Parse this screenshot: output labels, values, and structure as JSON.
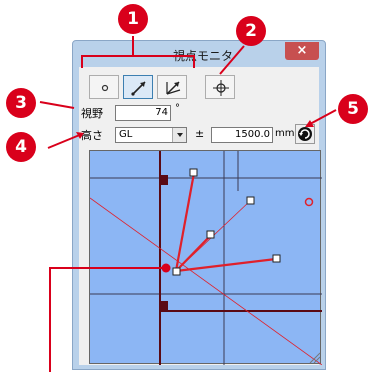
{
  "window": {
    "title": "視点モニタ",
    "close_label": "×"
  },
  "toolbar": {
    "buttons": [
      {
        "icon": "dot-icon",
        "active": false
      },
      {
        "icon": "pen-arrow-icon",
        "active": true
      },
      {
        "icon": "pen-multi-arrow-icon",
        "active": false
      },
      {
        "icon": "crosshair-icon",
        "active": false
      }
    ]
  },
  "view_field": {
    "label": "視野",
    "value": "74",
    "unit": "°"
  },
  "height_field": {
    "label": "高さ",
    "level_value": "GL",
    "plus_minus": "±",
    "offset_value": "1500.0",
    "unit": "mm"
  },
  "callouts": [
    "1",
    "2",
    "3",
    "4",
    "5"
  ],
  "colors": {
    "accent": "#d9001b",
    "viewport_bg": "#8cb6f4",
    "wall": "#5a0a14",
    "grid_line": "#3a3a55",
    "sight_line": "#e0202a"
  }
}
